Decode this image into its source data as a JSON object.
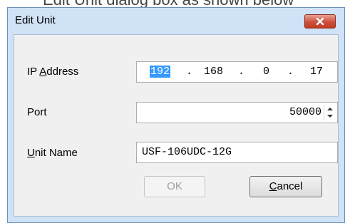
{
  "window": {
    "title": "Edit Unit",
    "top_text": "Edit Unit dialog box as shown below"
  },
  "icons": {
    "close": "close-icon",
    "spin": "spin-up-down-icon"
  },
  "fields": {
    "ip": {
      "label_prefix": "IP ",
      "label_mnemonic": "A",
      "label_rest": "ddress",
      "octets": [
        "192",
        "168",
        "0",
        "17"
      ],
      "separator": "."
    },
    "port": {
      "label": "Port",
      "value": "50000"
    },
    "name": {
      "label_mnemonic": "U",
      "label_rest": "nit Name",
      "value": "USF-106UDC-12G"
    }
  },
  "buttons": {
    "ok": {
      "label": "OK",
      "enabled": false
    },
    "cancel": {
      "label_mnemonic": "C",
      "label_rest": "ancel"
    }
  },
  "colors": {
    "titlebar": "#cfe2f6",
    "close": "#c94f3c",
    "selection": "#3399ff"
  }
}
